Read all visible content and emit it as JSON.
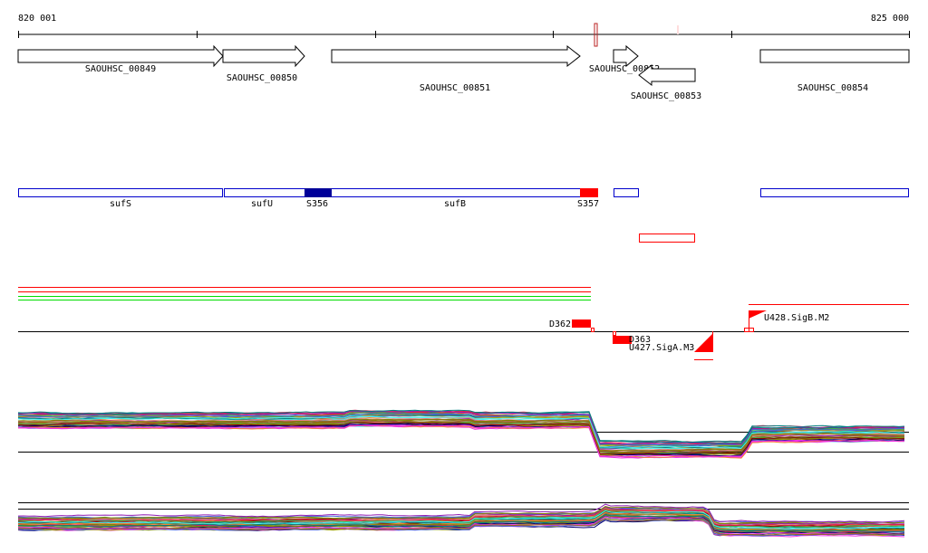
{
  "ruler": {
    "start_label": "820 001",
    "end_label": "825 000",
    "start": 820001,
    "end": 825000
  },
  "genes": [
    {
      "id": "SAOUHSC_00849",
      "start": 820001,
      "end": 821155,
      "strand": "+"
    },
    {
      "id": "SAOUHSC_00850",
      "start": 821155,
      "end": 821615,
      "strand": "+"
    },
    {
      "id": "SAOUHSC_00851",
      "start": 821768,
      "end": 823164,
      "strand": "+"
    },
    {
      "id": "SAOUHSC_00852",
      "start": 823350,
      "end": 823490,
      "strand": "+"
    },
    {
      "id": "SAOUHSC_00853",
      "start": 823490,
      "end": 823810,
      "strand": "-"
    },
    {
      "id": "SAOUHSC_00854",
      "start": 824180,
      "end": 825000,
      "strand": "+"
    }
  ],
  "annotations": [
    {
      "label": "sufS",
      "color": "#0000cc"
    },
    {
      "label": "sufU",
      "color": "#0000cc"
    },
    {
      "label": "S356",
      "color": "#000099"
    },
    {
      "label": "sufB",
      "color": "#0000cc"
    },
    {
      "label": "S357",
      "color": "#ff0000"
    }
  ],
  "features": {
    "d362": "D362",
    "d363": "D363",
    "u427": "U427.SigA.M3",
    "u428": "U428.SigB.M2"
  },
  "colors": {
    "red": "#ff0000",
    "green": "#00dd00",
    "blue": "#0000cc",
    "navy": "#000099"
  }
}
